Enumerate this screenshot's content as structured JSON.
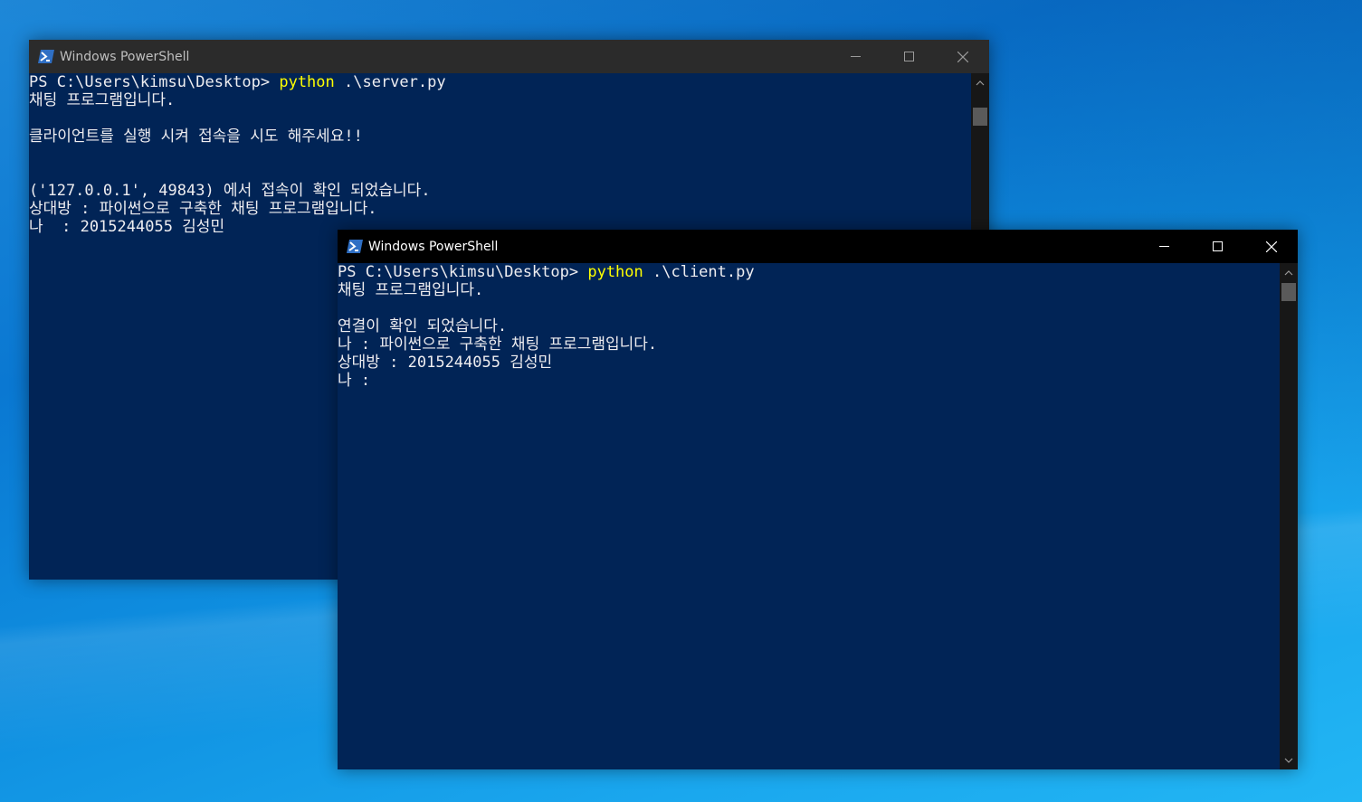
{
  "desktop": {
    "background_color": "#0a78d2"
  },
  "server_window": {
    "title": "Windows PowerShell",
    "prompt": "PS C:\\Users\\kimsu\\Desktop> ",
    "command": "python",
    "args": " .\\server.py",
    "lines": [
      "채팅 프로그램입니다.",
      "",
      "클라이언트를 실행 시켜 접속을 시도 해주세요!!",
      "",
      "",
      "('127.0.0.1', 49843) 에서 접속이 확인 되었습니다.",
      "상대방 : 파이썬으로 구축한 채팅 프로그램입니다.",
      "나  : 2015244055 김성민"
    ],
    "colors": {
      "background": "#012456",
      "titlebar": "#2b2b2b"
    }
  },
  "client_window": {
    "title": "Windows PowerShell",
    "prompt": "PS C:\\Users\\kimsu\\Desktop> ",
    "command": "python",
    "args": " .\\client.py",
    "lines": [
      "채팅 프로그램입니다.",
      "",
      "연결이 확인 되었습니다.",
      "나 : 파이썬으로 구축한 채팅 프로그램입니다.",
      "상대방 : 2015244055 김성민",
      "나 :"
    ],
    "colors": {
      "background": "#012456",
      "titlebar": "#000000"
    }
  },
  "titlebar_buttons": {
    "minimize": "minimize-icon",
    "maximize": "maximize-icon",
    "close": "close-icon"
  },
  "colors": {
    "command_highlight": "#ffff00",
    "console_text": "#eeedf0"
  }
}
